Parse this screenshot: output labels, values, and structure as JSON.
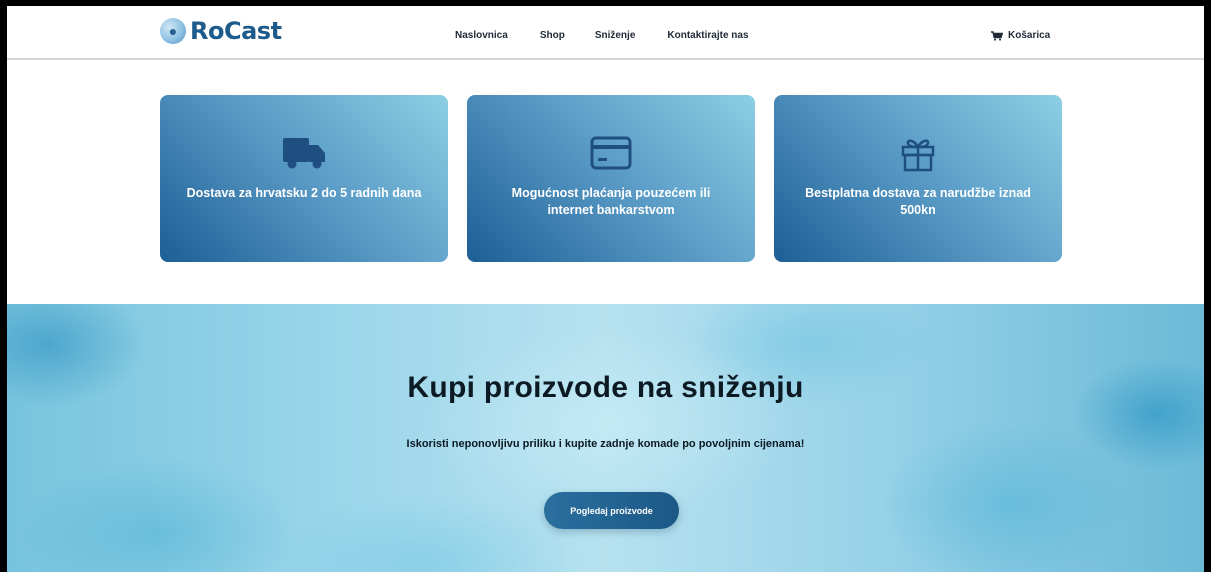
{
  "header": {
    "logo_text": "RoCast",
    "nav": [
      {
        "label": "Naslovnica"
      },
      {
        "label": "Shop"
      },
      {
        "label": "Sniženje"
      },
      {
        "label": "Kontaktirajte nas"
      }
    ],
    "cart_label": "Košarica",
    "brand_color": "#1d5b8c"
  },
  "features": [
    {
      "icon": "truck-icon",
      "text": "Dostava za hrvatsku 2 do 5 radnih dana"
    },
    {
      "icon": "credit-card-icon",
      "text": "Mogućnost plaćanja pouzećem ili internet bankarstvom"
    },
    {
      "icon": "gift-icon",
      "text": "Bestplatna dostava za narudžbe iznad 500kn"
    }
  ],
  "hero": {
    "title": "Kupi proizvode na sniženju",
    "subtitle": "Iskoristi neponovljivu priliku i kupite zadnje komade po povoljnim cijenama!",
    "button_label": "Pogledaj proizvode",
    "button_color": "#1c5886"
  }
}
